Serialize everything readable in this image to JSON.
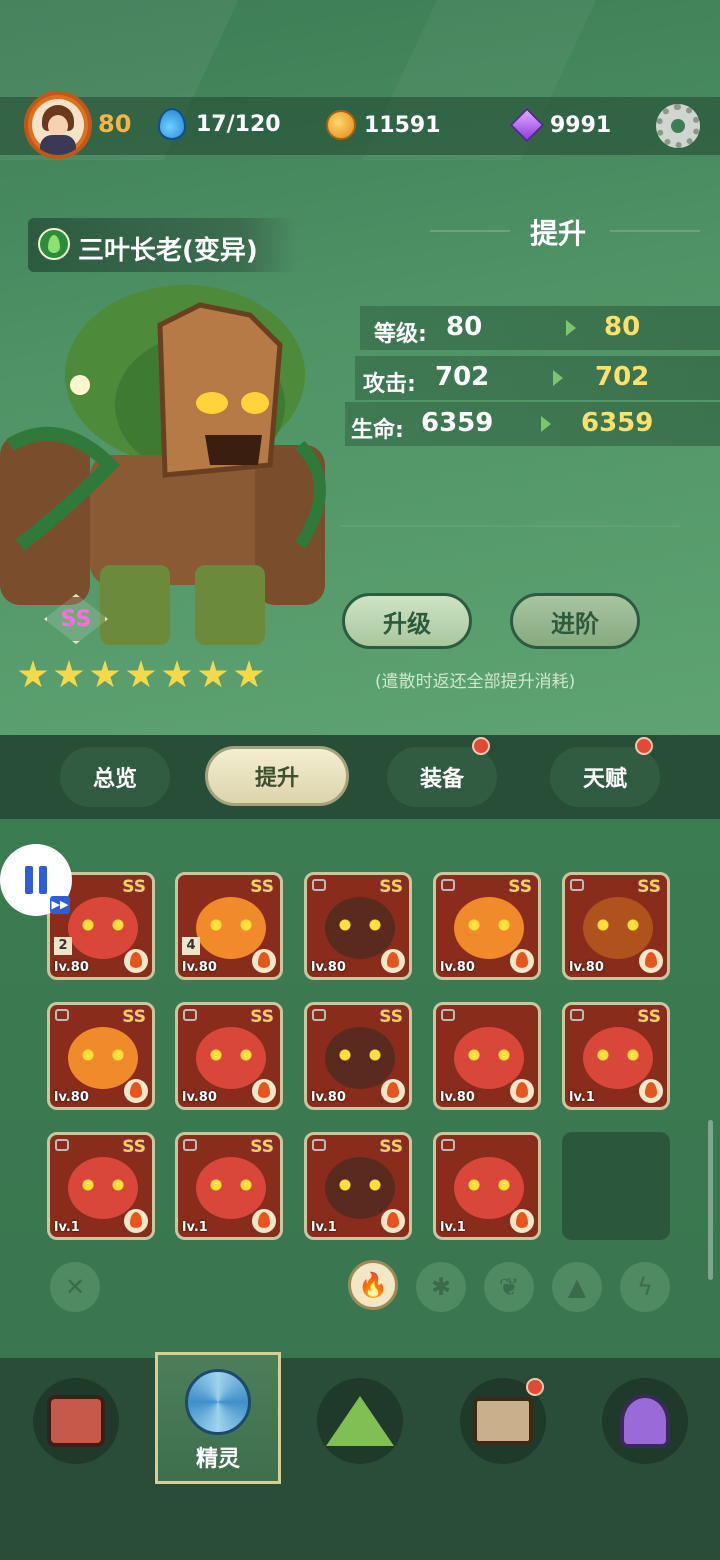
{
  "header": {
    "player_level": "80",
    "stamina": "17/120",
    "coins": "11591",
    "gems": "9991"
  },
  "hero": {
    "name": "三叶长老(变异)",
    "rarity": "SS",
    "stars": 7
  },
  "panel": {
    "title": "提升",
    "stats": [
      {
        "label": "等级:",
        "current": "80",
        "next": "80"
      },
      {
        "label": "攻击:",
        "current": "702",
        "next": "702"
      },
      {
        "label": "生命:",
        "current": "6359",
        "next": "6359"
      }
    ],
    "upgrade_button": "升级",
    "advance_button": "进阶",
    "note": "(遣散时返还全部提升消耗)"
  },
  "tabs": {
    "overview": "总览",
    "upgrade": "提升",
    "equipment": "装备",
    "talent": "天赋",
    "active": "upgrade"
  },
  "roster": [
    {
      "rarity": "SS",
      "level": "lv.80",
      "count": "2",
      "color": "red",
      "locked": false
    },
    {
      "rarity": "SS",
      "level": "lv.80",
      "count": "4",
      "color": "orange",
      "locked": false
    },
    {
      "rarity": "SS",
      "level": "lv.80",
      "count": "",
      "color": "dark",
      "locked": true
    },
    {
      "rarity": "SS",
      "level": "lv.80",
      "count": "",
      "color": "orange",
      "locked": true
    },
    {
      "rarity": "SS",
      "level": "lv.80",
      "count": "",
      "color": "brown",
      "locked": true
    },
    {
      "rarity": "SS",
      "level": "lv.80",
      "count": "",
      "color": "orange",
      "locked": true
    },
    {
      "rarity": "SS",
      "level": "lv.80",
      "count": "",
      "color": "red",
      "locked": true
    },
    {
      "rarity": "SS",
      "level": "lv.80",
      "count": "",
      "color": "dark",
      "locked": true
    },
    {
      "rarity": "",
      "level": "lv.80",
      "count": "",
      "color": "red",
      "locked": true
    },
    {
      "rarity": "SS",
      "level": "lv.1",
      "count": "",
      "color": "red",
      "locked": true
    },
    {
      "rarity": "SS",
      "level": "lv.1",
      "count": "",
      "color": "red",
      "locked": true
    },
    {
      "rarity": "SS",
      "level": "lv.1",
      "count": "",
      "color": "red",
      "locked": true
    },
    {
      "rarity": "SS",
      "level": "lv.1",
      "count": "",
      "color": "dark",
      "locked": true
    },
    {
      "rarity": "",
      "level": "lv.1",
      "count": "",
      "color": "red",
      "locked": true
    }
  ],
  "filters": [
    "close-icon",
    "fire-icon",
    "flower-icon",
    "leaf-icon",
    "rock-icon",
    "lightning-icon"
  ],
  "navbar": {
    "active_label": "精灵"
  },
  "colors": {
    "accent_gold": "#ffe06a",
    "badge_red": "#e34a35",
    "panel_green": "#2a4d37"
  }
}
